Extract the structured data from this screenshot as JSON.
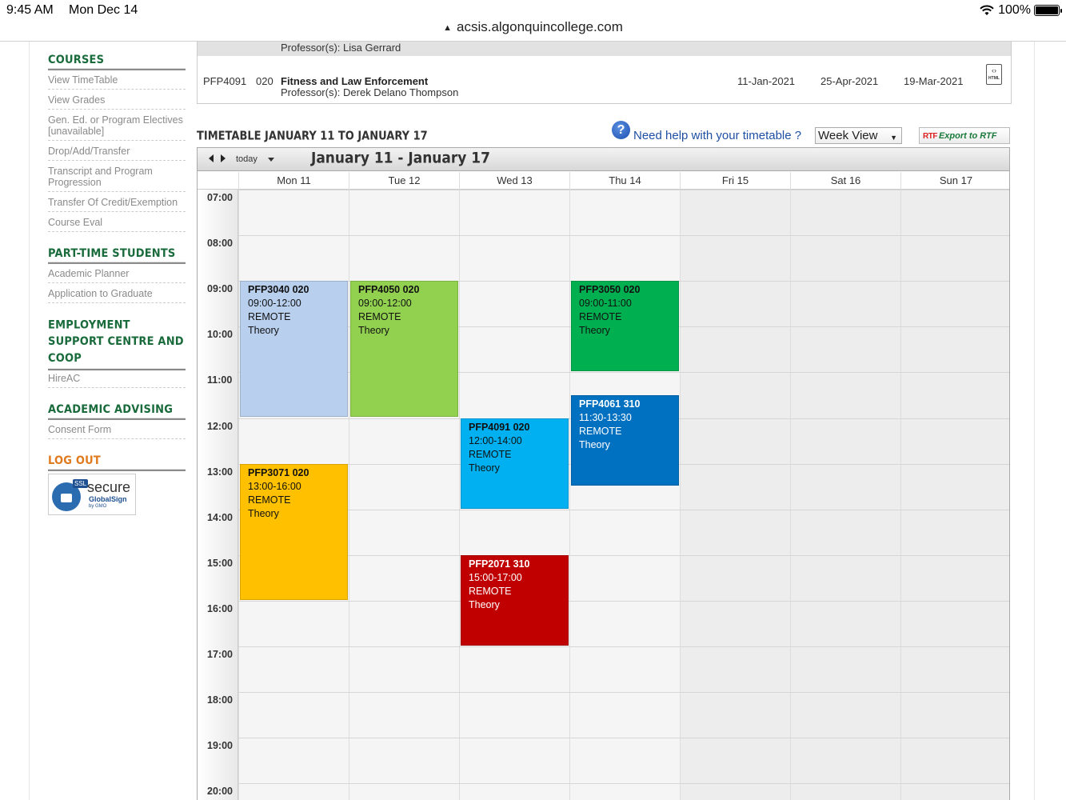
{
  "status_bar": {
    "time": "9:45 AM",
    "date": "Mon Dec 14",
    "battery": "100%"
  },
  "browser": {
    "url": "acsis.algonquincollege.com"
  },
  "sidebar": {
    "sections": [
      {
        "heading": "COURSES",
        "items": [
          "View TimeTable",
          "View Grades",
          "Gen. Ed. or Program Electives [unavailable]",
          "Drop/Add/Transfer",
          "Transcript and Program Progression",
          "Transfer Of Credit/Exemption",
          "Course Eval"
        ]
      },
      {
        "heading": "PART-TIME STUDENTS",
        "items": [
          "Academic Planner",
          "Application to Graduate"
        ]
      },
      {
        "heading": "EMPLOYMENT SUPPORT CENTRE AND COOP",
        "items": [
          "HireAC"
        ]
      },
      {
        "heading": "ACADEMIC ADVISING",
        "items": [
          "Consent Form"
        ]
      }
    ],
    "logout": "LOG OUT",
    "badge": {
      "ssl": "SSL",
      "secure": "secure",
      "globalsign": "GlobalSign",
      "gmo": "by GMO"
    }
  },
  "course_table": {
    "prev_professor": "Professor(s): Lisa Gerrard",
    "row": {
      "code": "PFP4091",
      "section": "020",
      "title": "Fitness and Law Enforcement",
      "professor": "Professor(s): Derek Delano Thompson",
      "start": "11-Jan-2021",
      "end": "25-Apr-2021",
      "drop_date": "19-Mar-2021",
      "icon_label": "HTML"
    }
  },
  "timetable": {
    "title": "TIMETABLE JANUARY 11 TO JANUARY 17",
    "help_text": "Need help with your timetable ?",
    "view_select": "Week View",
    "export_mark": "RTF",
    "export_label": "Export to RTF",
    "today_label": "today",
    "range_title": "January 11 - January 17",
    "days": [
      "Mon 11",
      "Tue 12",
      "Wed 13",
      "Thu 14",
      "Fri 15",
      "Sat 16",
      "Sun 17"
    ],
    "hours": [
      "07:00",
      "08:00",
      "09:00",
      "10:00",
      "11:00",
      "12:00",
      "13:00",
      "14:00",
      "15:00",
      "16:00",
      "17:00",
      "18:00",
      "19:00",
      "20:00"
    ],
    "events": [
      {
        "code": "PFP3040 020",
        "time": "09:00-12:00",
        "mode": "REMOTE",
        "type": "Theory",
        "day": 0,
        "start": 9,
        "end": 12,
        "bg": "#b8cfee",
        "fg": "#111111"
      },
      {
        "code": "PFP4050 020",
        "time": "09:00-12:00",
        "mode": "REMOTE",
        "type": "Theory",
        "day": 1,
        "start": 9,
        "end": 12,
        "bg": "#92d050",
        "fg": "#111111"
      },
      {
        "code": "PFP3050 020",
        "time": "09:00-11:00",
        "mode": "REMOTE",
        "type": "Theory",
        "day": 3,
        "start": 9,
        "end": 11,
        "bg": "#00b050",
        "fg": "#111111"
      },
      {
        "code": "PFP4061 310",
        "time": "11:30-13:30",
        "mode": "REMOTE",
        "type": "Theory",
        "day": 3,
        "start": 11.5,
        "end": 13.5,
        "bg": "#0070c0",
        "fg": "#ffffff"
      },
      {
        "code": "PFP4091 020",
        "time": "12:00-14:00",
        "mode": "REMOTE",
        "type": "Theory",
        "day": 2,
        "start": 12,
        "end": 14,
        "bg": "#00b0f0",
        "fg": "#111111"
      },
      {
        "code": "PFP3071 020",
        "time": "13:00-16:00",
        "mode": "REMOTE",
        "type": "Theory",
        "day": 0,
        "start": 13,
        "end": 16,
        "bg": "#ffc000",
        "fg": "#111111"
      },
      {
        "code": "PFP2071 310",
        "time": "15:00-17:00",
        "mode": "REMOTE",
        "type": "Theory",
        "day": 2,
        "start": 15,
        "end": 17,
        "bg": "#c00000",
        "fg": "#ffffff"
      }
    ]
  },
  "colors": {
    "sidebar_heading": "#1a6b3c",
    "logout": "#e07a1e",
    "link": "#1f4fa3"
  }
}
